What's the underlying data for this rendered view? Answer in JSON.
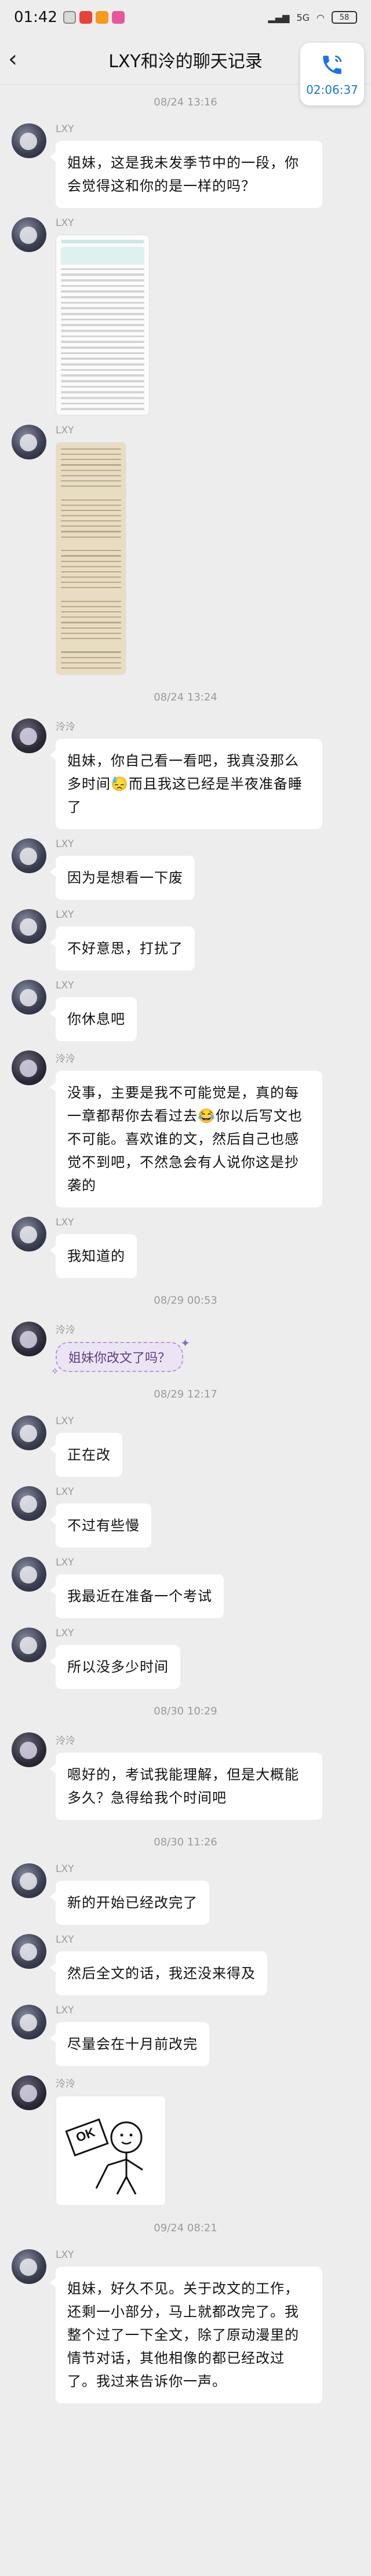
{
  "status": {
    "time": "01:42",
    "network": "5G",
    "battery": "58"
  },
  "header": {
    "title": "LXY和泠的聊天记录",
    "call_time": "02:06:37"
  },
  "messages": [
    {
      "kind": "time",
      "text": "08/24 13:16"
    },
    {
      "kind": "text",
      "sender": "LXY",
      "avatar": "a",
      "text": "姐妹，这是我未发季节中的一段，你会觉得这和你的是一样的吗？"
    },
    {
      "kind": "image",
      "sender": "LXY",
      "avatar": "a",
      "variant": "shot1"
    },
    {
      "kind": "image",
      "sender": "LXY",
      "avatar": "a",
      "variant": "shot2"
    },
    {
      "kind": "time",
      "text": "08/24 13:24"
    },
    {
      "kind": "text",
      "sender": "泠泠",
      "avatar": "b",
      "text": "姐妹，你自己看一看吧，我真没那么多时间😓而且我这已经是半夜准备睡了"
    },
    {
      "kind": "text",
      "sender": "LXY",
      "avatar": "a",
      "text": "因为是想看一下废"
    },
    {
      "kind": "text",
      "sender": "LXY",
      "avatar": "a",
      "text": "不好意思，打扰了"
    },
    {
      "kind": "text",
      "sender": "LXY",
      "avatar": "a",
      "text": "你休息吧"
    },
    {
      "kind": "text",
      "sender": "泠泠",
      "avatar": "b",
      "text": "没事，主要是我不可能觉是，真的每一章都帮你去看过去😂你以后写文也不可能。喜欢谁的文，然后自己也感觉不到吧，不然急会有人说你这是抄袭的"
    },
    {
      "kind": "text",
      "sender": "LXY",
      "avatar": "a",
      "text": "我知道的"
    },
    {
      "kind": "time",
      "text": "08/29 00:53"
    },
    {
      "kind": "special",
      "sender": "泠泠",
      "avatar": "b",
      "text": "姐妹你改文了吗？"
    },
    {
      "kind": "time",
      "text": "08/29 12:17"
    },
    {
      "kind": "text",
      "sender": "LXY",
      "avatar": "a",
      "text": "正在改"
    },
    {
      "kind": "text",
      "sender": "LXY",
      "avatar": "a",
      "text": "不过有些慢"
    },
    {
      "kind": "text",
      "sender": "LXY",
      "avatar": "a",
      "text": "我最近在准备一个考试"
    },
    {
      "kind": "text",
      "sender": "LXY",
      "avatar": "a",
      "text": "所以没多少时间"
    },
    {
      "kind": "time",
      "text": "08/30 10:29"
    },
    {
      "kind": "text",
      "sender": "泠泠",
      "avatar": "b",
      "text": "嗯好的，考试我能理解，但是大概能多久？急得给我个时间吧"
    },
    {
      "kind": "time",
      "text": "08/30 11:26"
    },
    {
      "kind": "text",
      "sender": "LXY",
      "avatar": "a",
      "text": "新的开始已经改完了"
    },
    {
      "kind": "text",
      "sender": "LXY",
      "avatar": "a",
      "text": "然后全文的话，我还没来得及"
    },
    {
      "kind": "text",
      "sender": "LXY",
      "avatar": "a",
      "text": "尽量会在十月前改完"
    },
    {
      "kind": "sticker",
      "sender": "泠泠",
      "avatar": "b",
      "text": "OK"
    },
    {
      "kind": "time",
      "text": "09/24 08:21"
    },
    {
      "kind": "text",
      "sender": "LXY",
      "avatar": "a",
      "text": "姐妹，好久不见。关于改文的工作，还剩一小部分，马上就都改完了。我整个过了一下全文，除了原动漫里的情节对话，其他相像的都已经改过了。我过来告诉你一声。"
    }
  ]
}
